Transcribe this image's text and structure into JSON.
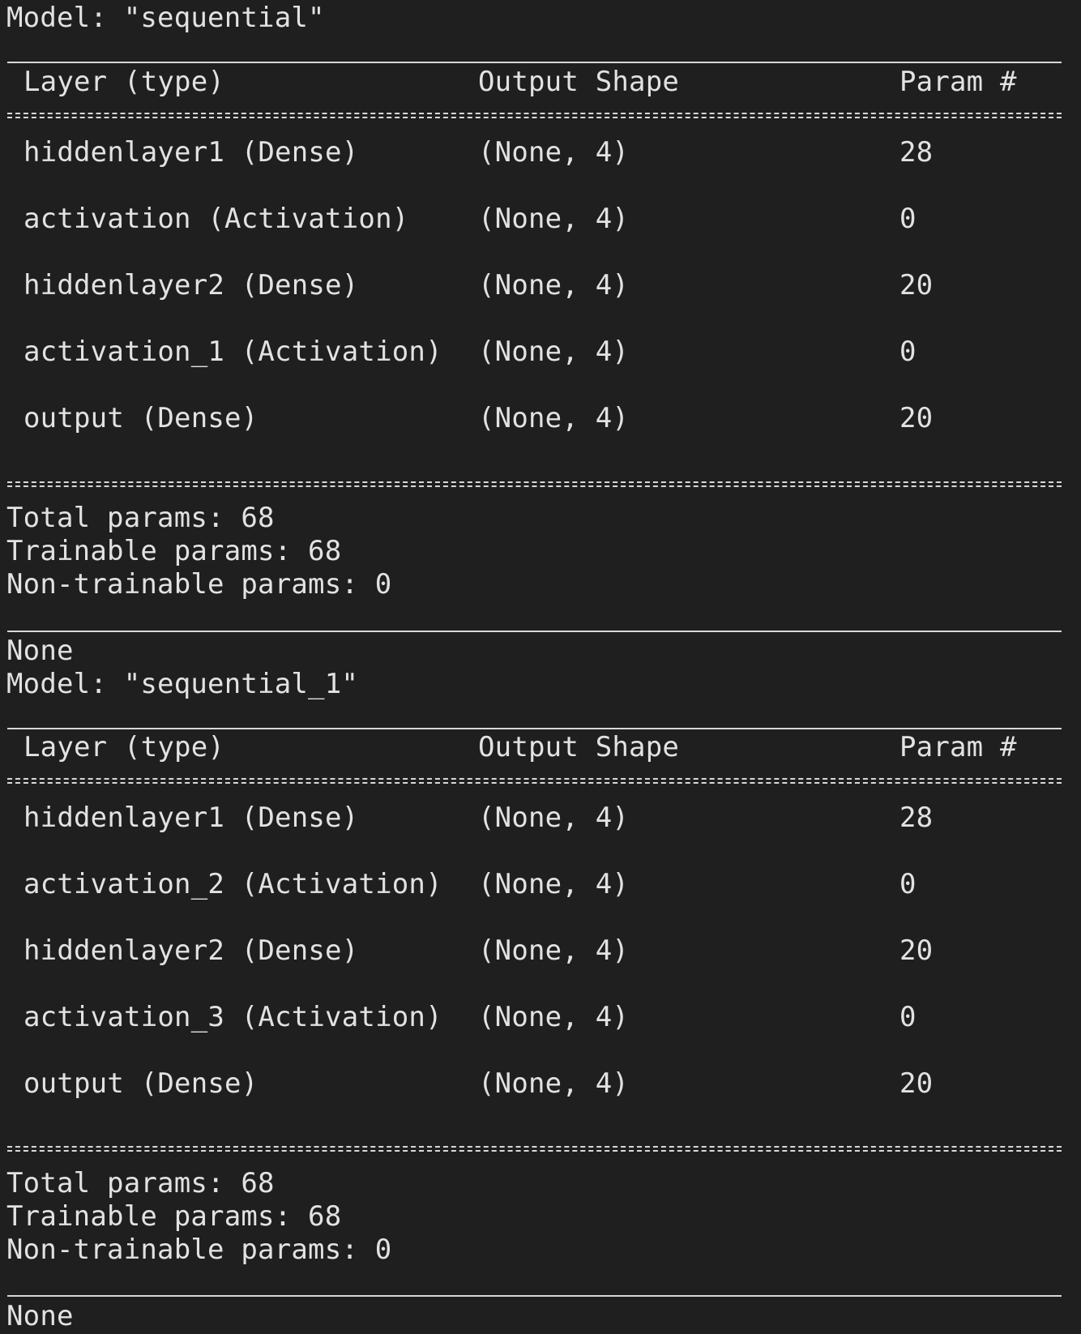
{
  "models": [
    {
      "title": "Model: \"sequential\"",
      "headers": {
        "layer": "Layer (type)",
        "shape": "Output Shape",
        "param": "Param #"
      },
      "rows": [
        {
          "layer": "hiddenlayer1 (Dense)",
          "shape": "(None, 4)",
          "param": "28"
        },
        {
          "layer": "activation (Activation)",
          "shape": "(None, 4)",
          "param": "0"
        },
        {
          "layer": "hiddenlayer2 (Dense)",
          "shape": "(None, 4)",
          "param": "20"
        },
        {
          "layer": "activation_1 (Activation)",
          "shape": "(None, 4)",
          "param": "0"
        },
        {
          "layer": "output (Dense)",
          "shape": "(None, 4)",
          "param": "20"
        }
      ],
      "total": "Total params: 68",
      "trainable": "Trainable params: 68",
      "non_trainable": "Non-trainable params: 0",
      "return_value": "None"
    },
    {
      "title": "Model: \"sequential_1\"",
      "headers": {
        "layer": "Layer (type)",
        "shape": "Output Shape",
        "param": "Param #"
      },
      "rows": [
        {
          "layer": "hiddenlayer1 (Dense)",
          "shape": "(None, 4)",
          "param": "28"
        },
        {
          "layer": "activation_2 (Activation)",
          "shape": "(None, 4)",
          "param": "0"
        },
        {
          "layer": "hiddenlayer2 (Dense)",
          "shape": "(None, 4)",
          "param": "20"
        },
        {
          "layer": "activation_3 (Activation)",
          "shape": "(None, 4)",
          "param": "0"
        },
        {
          "layer": "output (Dense)",
          "shape": "(None, 4)",
          "param": "20"
        }
      ],
      "total": "Total params: 68",
      "trainable": "Trainable params: 68",
      "non_trainable": "Non-trainable params: 0",
      "return_value": "None"
    }
  ],
  "colors": {
    "background": "#1f1f1f",
    "text": "#e2e2e2"
  }
}
